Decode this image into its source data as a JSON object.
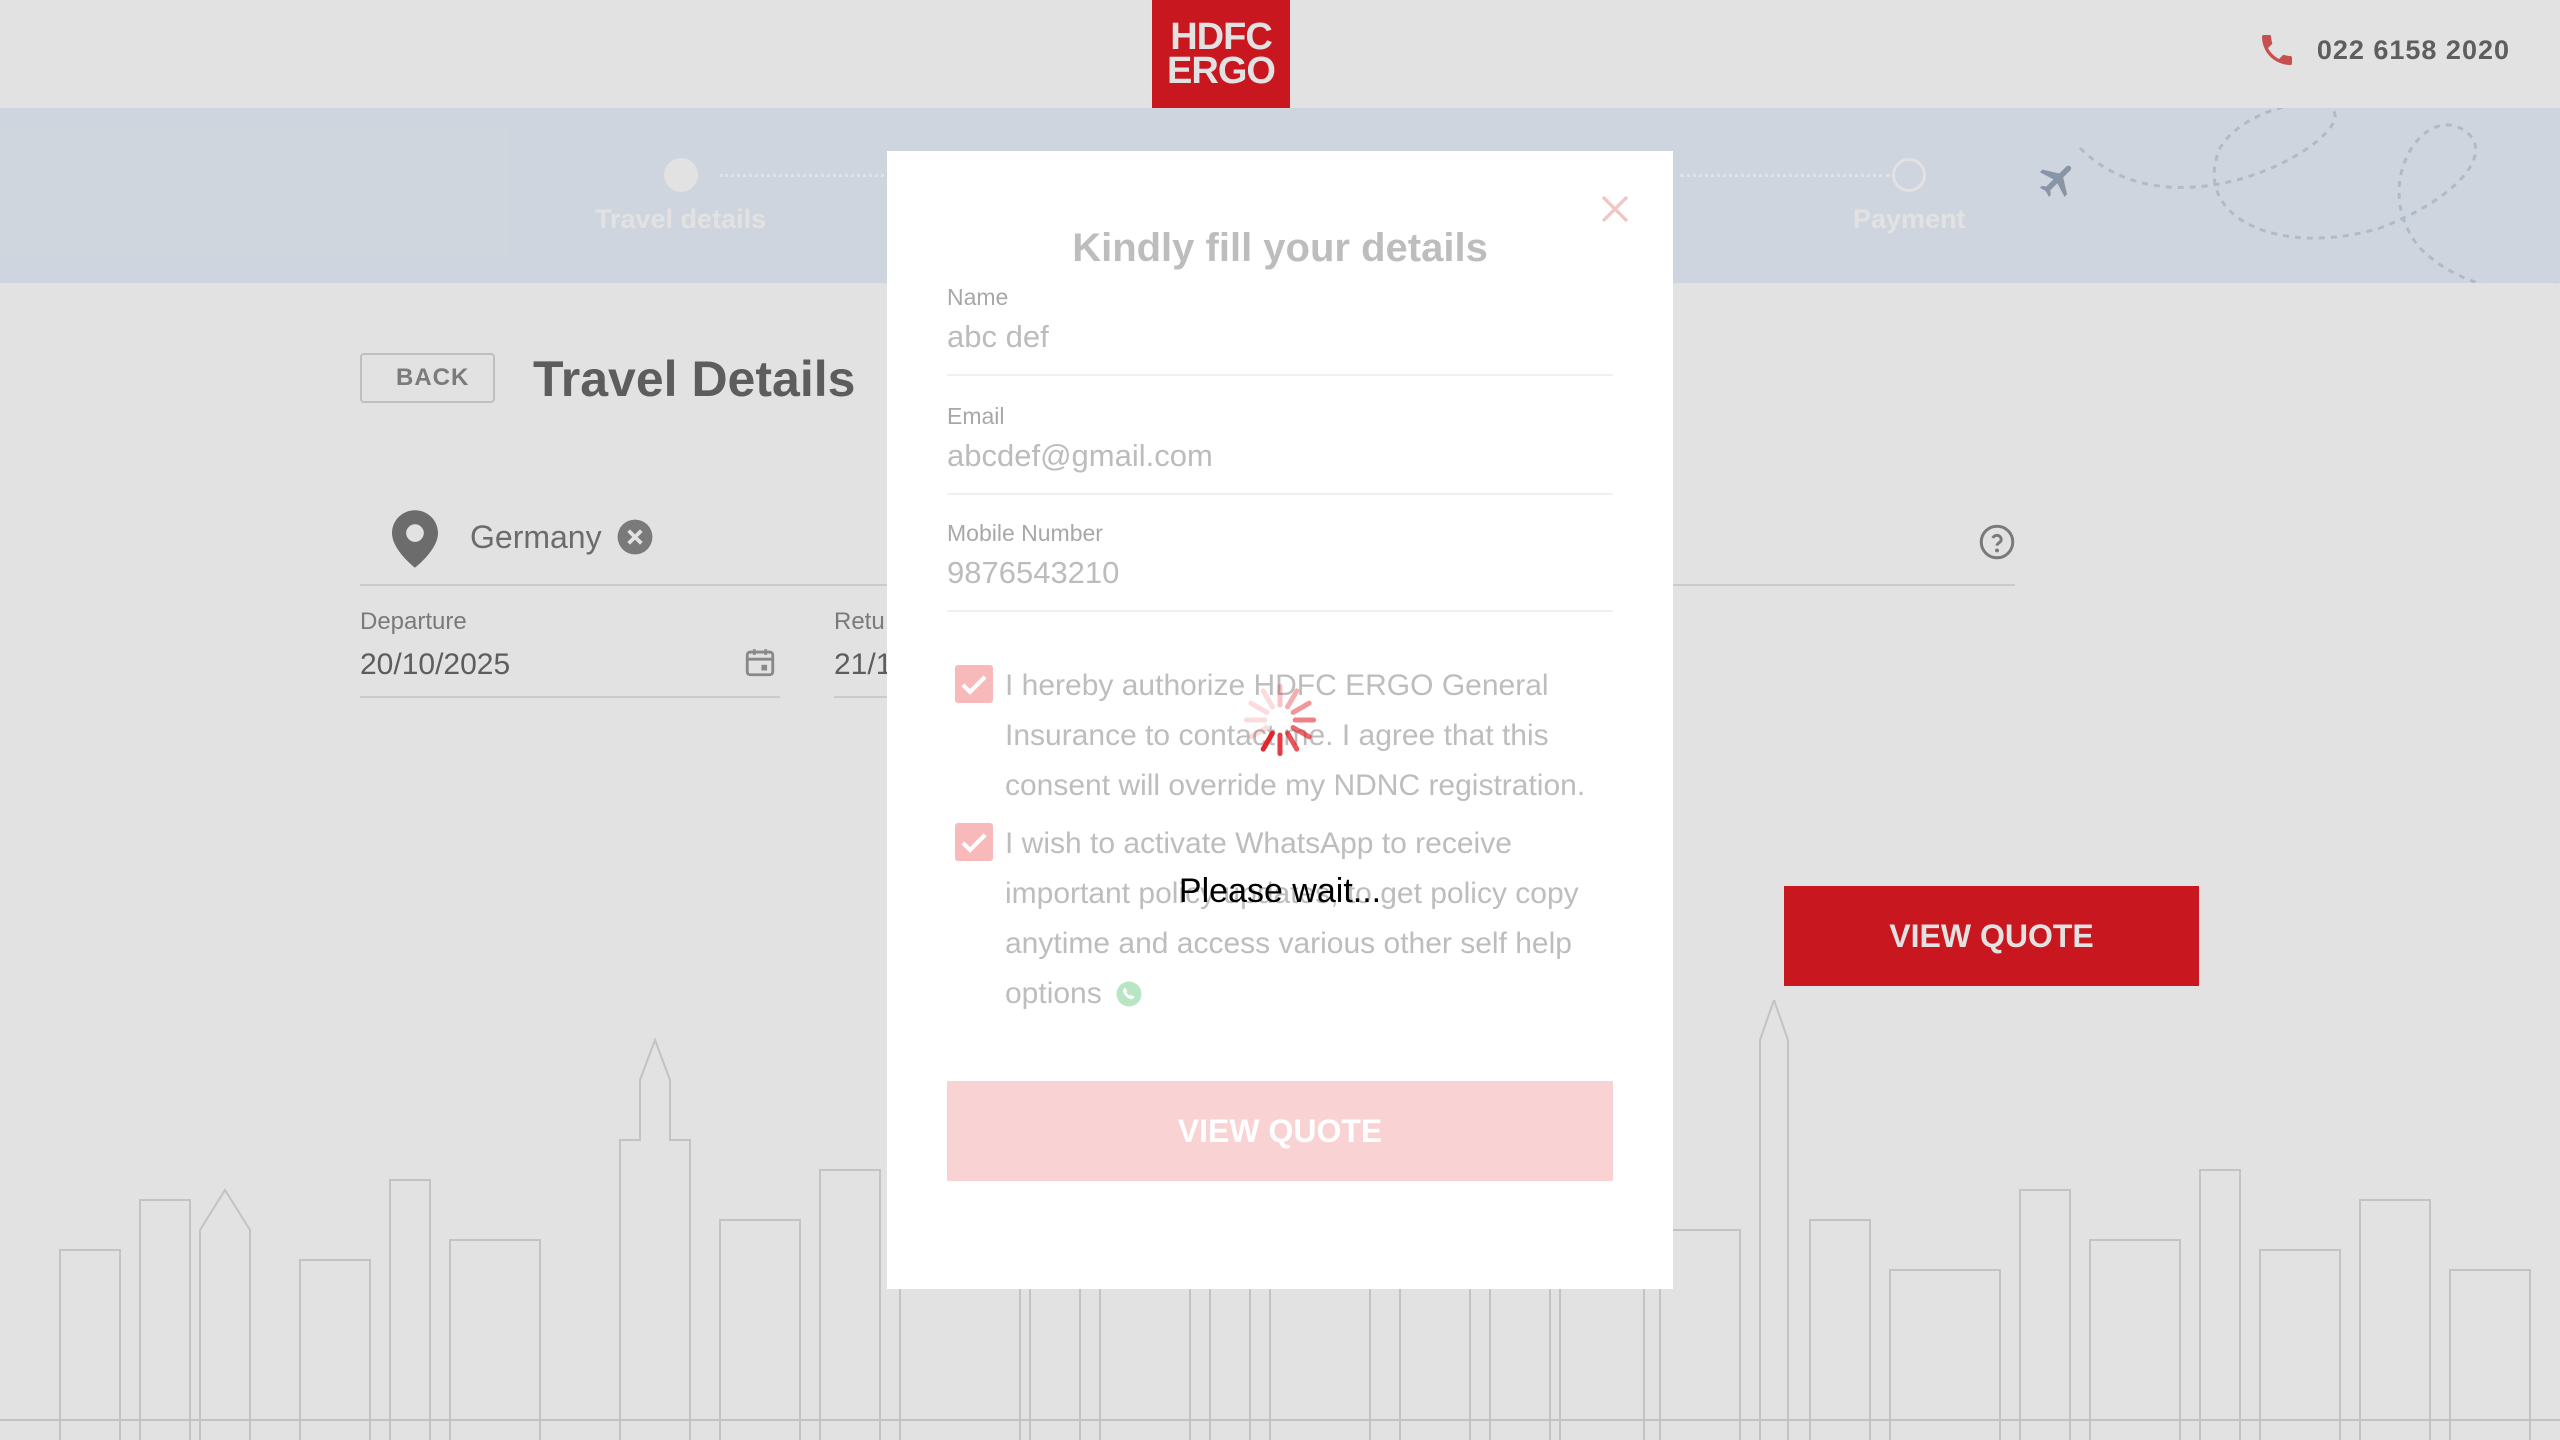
{
  "header": {
    "logo_line1": "HDFC",
    "logo_line2": "ERGO",
    "logo_color": "#e21b23",
    "phone_icon": "phone-icon",
    "phone_number": "022 6158 2020"
  },
  "stepper": {
    "steps": [
      {
        "label": "Travel details",
        "state": "active"
      },
      {
        "label": "Payment",
        "state": "pending"
      }
    ],
    "decor_icon": "airplane-icon"
  },
  "page": {
    "back_label": "BACK",
    "title": "Travel Details",
    "destination_icon": "location-pin-icon",
    "destination_chip": "Germany",
    "help_icon": "help-icon",
    "departure_label": "Departure",
    "departure_value": "20/10/2025",
    "return_label": "Retu",
    "return_value": "21/1",
    "calendar_icon": "calendar-icon",
    "view_quote_label": "VIEW QUOTE"
  },
  "modal": {
    "title": "Kindly fill your details",
    "close_icon": "close-icon",
    "fields": [
      {
        "label": "Name",
        "value": "abc def"
      },
      {
        "label": "Email",
        "value": "abcdef@gmail.com"
      },
      {
        "label": "Mobile Number",
        "value": "9876543210"
      }
    ],
    "consents": [
      {
        "checked": true,
        "text": "I hereby authorize HDFC ERGO General Insurance to contact me. I agree that this consent will override my NDNC registration."
      },
      {
        "checked": true,
        "text": "I wish to activate WhatsApp to receive important policy updates, to get policy copy anytime and access various other self help options"
      }
    ],
    "whatsapp_icon": "whatsapp-icon",
    "submit_label": "VIEW QUOTE"
  },
  "loader": {
    "text": "Please wait...",
    "spinner_icon": "spinner-icon",
    "color": "#e21b23"
  }
}
